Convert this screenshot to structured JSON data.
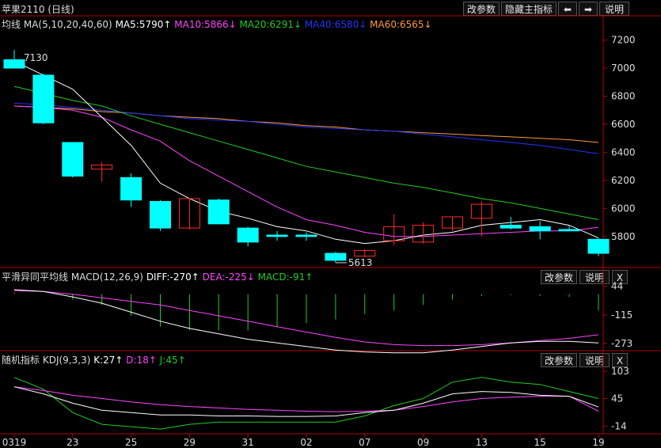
{
  "title": "苹果2110 (日线)",
  "toolbar": {
    "params_label": "改参数",
    "hide_indicator_label": "隐藏主指标",
    "prev_icon": "left-arrow-icon",
    "next_icon": "right-arrow-icon",
    "help_label": "说明"
  },
  "main_legend": {
    "name": "均线",
    "params": "MA(5,10,20,40,60)",
    "ma5": "MA5:5790↑",
    "ma10": "MA10:5866↓",
    "ma20": "MA20:6291↓",
    "ma40": "MA40:6580↓",
    "ma60": "MA60:6565↓"
  },
  "macd_legend": {
    "name": "平滑异同平均线",
    "params": "MACD(12,26,9)",
    "diff": "DIFF:-270↑",
    "dea": "DEA:-225↓",
    "macd": "MACD:-91↑",
    "params_label": "改参数",
    "help_label": "说明",
    "close_label": "X"
  },
  "kdj_legend": {
    "name": "随机指标",
    "params": "KDJ(9,3,3)",
    "k": "K:27↑",
    "d": "D:18↑",
    "j": "J:45↑",
    "params_label": "改参数",
    "help_label": "说明",
    "close_label": "X"
  },
  "colors": {
    "up": "#ff2a2a",
    "down": "#00ffff",
    "ma5": "#ffffff",
    "ma10": "#ff44ff",
    "ma20": "#22cc22",
    "ma40": "#2233ff",
    "ma60": "#ff9933",
    "axis": "#b40000",
    "text": "#dddddd"
  },
  "annotations": {
    "high": "7130",
    "low": "5613"
  },
  "x_ticks": [
    "0319",
    "23",
    "25",
    "29",
    "31",
    "02",
    "07",
    "09",
    "13",
    "15",
    "19"
  ],
  "chart_data": [
    {
      "type": "candlestick",
      "title": "苹果2110 (日线)",
      "y_ticks": [
        7200,
        7000,
        6800,
        6600,
        6400,
        6200,
        6000,
        5800
      ],
      "ylim": [
        5590,
        7260
      ],
      "candles": [
        {
          "o": 7060,
          "h": 7130,
          "l": 7000,
          "c": 7000
        },
        {
          "o": 6950,
          "h": 6960,
          "l": 6600,
          "c": 6610
        },
        {
          "o": 6470,
          "h": 6470,
          "l": 6220,
          "c": 6230
        },
        {
          "o": 6280,
          "h": 6330,
          "l": 6190,
          "c": 6310
        },
        {
          "o": 6220,
          "h": 6250,
          "l": 6010,
          "c": 6060
        },
        {
          "o": 6050,
          "h": 6060,
          "l": 5840,
          "c": 5860
        },
        {
          "o": 5860,
          "h": 6070,
          "l": 5850,
          "c": 6070
        },
        {
          "o": 6060,
          "h": 6070,
          "l": 5890,
          "c": 5890
        },
        {
          "o": 5860,
          "h": 5870,
          "l": 5730,
          "c": 5760
        },
        {
          "o": 5810,
          "h": 5840,
          "l": 5770,
          "c": 5800
        },
        {
          "o": 5810,
          "h": 5830,
          "l": 5770,
          "c": 5800
        },
        {
          "o": 5680,
          "h": 5690,
          "l": 5613,
          "c": 5630
        },
        {
          "o": 5660,
          "h": 5710,
          "l": 5650,
          "c": 5700
        },
        {
          "o": 5770,
          "h": 5960,
          "l": 5740,
          "c": 5870
        },
        {
          "o": 5760,
          "h": 5900,
          "l": 5750,
          "c": 5880
        },
        {
          "o": 5860,
          "h": 5940,
          "l": 5840,
          "c": 5940
        },
        {
          "o": 5930,
          "h": 6050,
          "l": 5800,
          "c": 6030
        },
        {
          "o": 5880,
          "h": 5940,
          "l": 5850,
          "c": 5860
        },
        {
          "o": 5870,
          "h": 5910,
          "l": 5780,
          "c": 5840
        },
        {
          "o": 5850,
          "h": 5880,
          "l": 5840,
          "c": 5840
        },
        {
          "o": 5780,
          "h": 5790,
          "l": 5660,
          "c": 5680
        }
      ],
      "ma5": [
        7050,
        6950,
        6850,
        6650,
        6450,
        6180,
        6070,
        5980,
        5930,
        5870,
        5840,
        5780,
        5750,
        5770,
        5810,
        5830,
        5880,
        5900,
        5920,
        5880,
        5790
      ],
      "ma10": [
        6730,
        6720,
        6700,
        6650,
        6560,
        6480,
        6340,
        6230,
        6120,
        6010,
        5920,
        5880,
        5830,
        5800,
        5800,
        5810,
        5820,
        5830,
        5840,
        5840,
        5866
      ],
      "ma20": [
        6870,
        6820,
        6770,
        6730,
        6660,
        6600,
        6540,
        6480,
        6420,
        6360,
        6300,
        6260,
        6220,
        6180,
        6150,
        6110,
        6070,
        6040,
        6000,
        5960,
        5920
      ],
      "ma40": [
        6750,
        6740,
        6720,
        6700,
        6680,
        6660,
        6640,
        6630,
        6620,
        6600,
        6580,
        6570,
        6560,
        6550,
        6530,
        6510,
        6490,
        6470,
        6450,
        6420,
        6390
      ],
      "ma60": [
        6730,
        6720,
        6710,
        6690,
        6680,
        6660,
        6650,
        6640,
        6620,
        6610,
        6590,
        6580,
        6560,
        6550,
        6540,
        6530,
        6520,
        6510,
        6500,
        6490,
        6470
      ]
    },
    {
      "type": "line",
      "title": "MACD(12,26,9)",
      "y_ticks": [
        44,
        -115,
        -273
      ],
      "ylim": [
        -300,
        60
      ],
      "diff": [
        25,
        15,
        -15,
        -50,
        -100,
        -150,
        -190,
        -220,
        -250,
        -270,
        -290,
        -310,
        -320,
        -325,
        -325,
        -310,
        -290,
        -270,
        -262,
        -262,
        -270
      ],
      "dea": [
        20,
        15,
        0,
        -20,
        -40,
        -60,
        -90,
        -120,
        -150,
        -180,
        -210,
        -240,
        -265,
        -280,
        -285,
        -285,
        -280,
        -270,
        -258,
        -245,
        -225
      ],
      "macd": [
        10,
        0,
        -30,
        -60,
        -120,
        -180,
        -200,
        -200,
        -200,
        -180,
        -160,
        -140,
        -110,
        -90,
        -60,
        -30,
        -10,
        -5,
        -10,
        -15,
        -91
      ]
    },
    {
      "type": "line",
      "title": "KDJ(9,3,3)",
      "y_ticks": [
        103,
        45,
        -14
      ],
      "ylim": [
        -30,
        115
      ],
      "k": [
        70,
        55,
        35,
        20,
        15,
        10,
        10,
        8,
        8,
        7,
        7,
        8,
        15,
        20,
        35,
        55,
        60,
        58,
        52,
        50,
        27
      ],
      "d": [
        70,
        62,
        52,
        45,
        38,
        32,
        28,
        25,
        22,
        20,
        18,
        17,
        18,
        20,
        28,
        38,
        45,
        48,
        50,
        50,
        18
      ],
      "j": [
        90,
        65,
        15,
        -10,
        -15,
        -20,
        -10,
        -5,
        -5,
        -5,
        -5,
        -5,
        8,
        30,
        45,
        80,
        90,
        80,
        75,
        60,
        45
      ]
    }
  ]
}
